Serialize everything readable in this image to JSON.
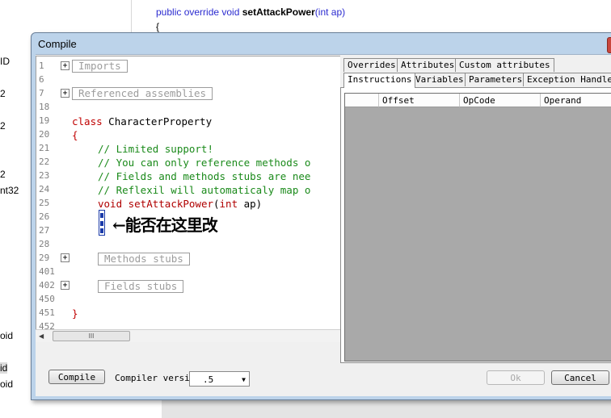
{
  "background": {
    "left_labels": [
      "ID",
      "2",
      "2",
      "2",
      "nt32",
      "oid",
      "id",
      "oid"
    ],
    "code_line1_kw": "public override void ",
    "code_line1_method": "setAttackPower",
    "code_line1_args": "(int ap)",
    "code_line2": "{"
  },
  "dialog": {
    "title": "Compile"
  },
  "editor": {
    "line_numbers": [
      "1",
      "6",
      "7",
      "18",
      "19",
      "20",
      "21",
      "22",
      "23",
      "24",
      "25",
      "26",
      "27",
      "28",
      "29",
      "401",
      "402",
      "450",
      "451",
      "452"
    ],
    "regions": {
      "imports": "Imports",
      "referenced_assemblies": "Referenced assemblies",
      "methods_stubs": "Methods stubs",
      "fields_stubs": "Fields stubs"
    },
    "class_keyword": "class",
    "class_name": " CharacterProperty",
    "open_brace": "{",
    "comments": [
      "// Limited support!",
      "// You can only reference methods o",
      "// Fields and methods stubs are nee",
      "// Reflexil will automaticaly map o"
    ],
    "method_void": "void",
    "method_name": " setAttackPower",
    "method_paren_open": "(",
    "method_int": "int",
    "method_rest": " ap)",
    "close_brace": "}",
    "handwritten_note": "←能否在这里改"
  },
  "tabs": {
    "row1": [
      "Overrides",
      "Attributes",
      "Custom attributes"
    ],
    "row2": [
      "Instructions",
      "Variables",
      "Parameters",
      "Exception Handlers"
    ],
    "active": "Instructions"
  },
  "grid": {
    "columns": [
      "",
      "Offset",
      "OpCode",
      "Operand"
    ]
  },
  "footer": {
    "compile_label": "Compile",
    "compiler_version_label": "Compiler version:",
    "compiler_version_value": ".5",
    "ok_label": "Ok",
    "cancel_label": "Cancel"
  }
}
